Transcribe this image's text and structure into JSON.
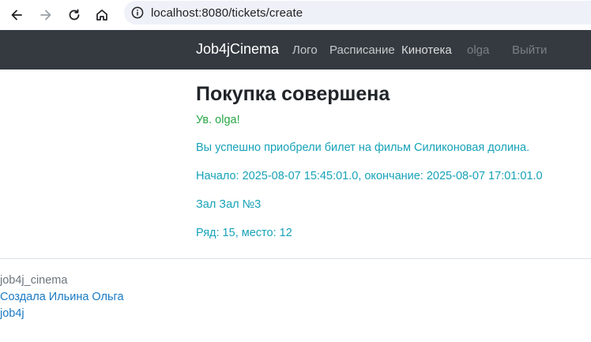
{
  "browser": {
    "url": "localhost:8080/tickets/create"
  },
  "navbar": {
    "brand": "Job4jCinema",
    "links": [
      {
        "label": "Лого"
      },
      {
        "label": "Расписание"
      },
      {
        "label": "Кинотека"
      },
      {
        "label": "olga"
      },
      {
        "label": "Выйти"
      }
    ]
  },
  "main": {
    "title": "Покупка совершена",
    "greeting": "Ув. olga!",
    "purchase_message": "Вы успешно приобрели билет на фильм Силиконовая долина.",
    "session_time": "Начало: 2025-08-07 15:45:01.0, окончание: 2025-08-07 17:01:01.0",
    "hall": "Зал Зал №3",
    "seat": "Ряд: 15, место: 12"
  },
  "footer": {
    "project": "job4j_cinema",
    "author_link": "Создала Ильина Ольга",
    "school_link": "job4j"
  },
  "colors": {
    "navbar_bg": "#343a40",
    "greeting": "#28a745",
    "info_text": "#17a2b8",
    "link": "#1a7ac4"
  }
}
